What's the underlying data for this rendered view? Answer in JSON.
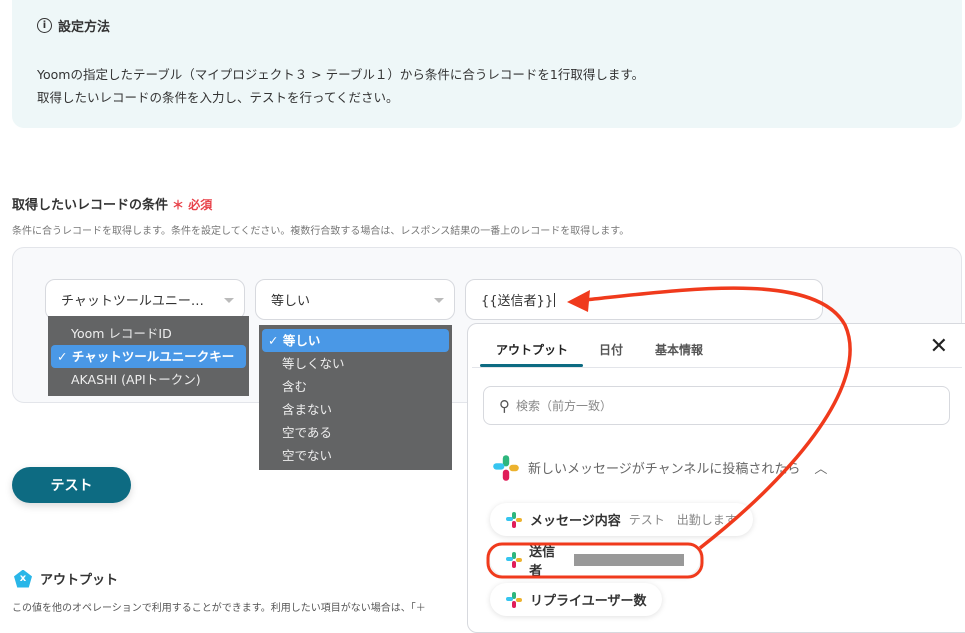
{
  "info": {
    "title": "設定方法",
    "lines": [
      "Yoomの指定したテーブル（マイプロジェクト３ > テーブル１）から条件に合うレコードを1行取得します。",
      "取得したいレコードの条件を入力し、テストを行ってください。"
    ]
  },
  "condition": {
    "title": "取得したいレコードの条件",
    "required": "必須",
    "description": "条件に合うレコードを取得します。条件を設定してください。複数行合致する場合は、レスポンス結果の一番上のレコードを取得します。",
    "field_select": "チャットツールユニー…",
    "field_options": [
      "Yoom レコードID",
      "✓ チャットツールユニークキー",
      "AKASHI (APIトークン)"
    ],
    "operator_select": "等しい",
    "operator_options": [
      "✓ 等しい",
      "等しくない",
      "含む",
      "含まない",
      "空である",
      "空でない"
    ],
    "value": "{{送信者}}"
  },
  "test_button": "テスト",
  "popup": {
    "tabs": [
      "アウトプット",
      "日付",
      "基本情報"
    ],
    "search_placeholder": "検索（前方一致）",
    "group": "新しいメッセージがチャンネルに投稿されたら",
    "items": [
      {
        "label": "メッセージ内容",
        "value": "テスト　出勤します"
      },
      {
        "label": "送信者",
        "value": ""
      },
      {
        "label": "リプライユーザー数",
        "value": ""
      }
    ]
  },
  "output": {
    "title": "アウトプット",
    "description": "この値を他のオペレーションで利用することができます。利用したい項目がない場合は、「＋"
  },
  "colors": {
    "accent": "#0d6b82",
    "annotation": "#f03a1c",
    "required": "#e8424a"
  }
}
